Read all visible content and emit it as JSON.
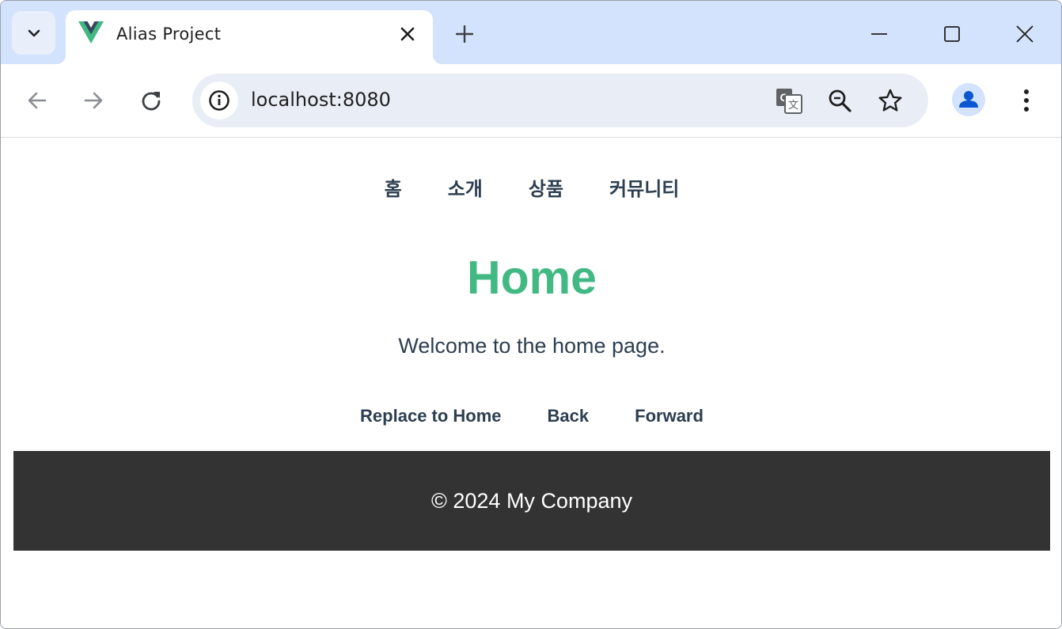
{
  "browser": {
    "tab": {
      "title": "Alias Project",
      "favicon": "vue-logo-icon"
    },
    "url": "localhost:8080",
    "icons": {
      "tab_search": "chevron-down-icon",
      "close_tab": "close-icon",
      "new_tab": "plus-icon",
      "minimize": "minimize-icon",
      "maximize": "maximize-icon",
      "close_window": "close-icon",
      "back": "arrow-left-icon",
      "forward": "arrow-right-icon",
      "reload": "reload-icon",
      "site_info": "info-icon",
      "translate": "translate-icon",
      "zoom": "zoom-out-icon",
      "bookmark": "star-icon",
      "profile": "person-icon",
      "menu": "more-vert-icon"
    }
  },
  "page": {
    "nav": [
      {
        "label": "홈"
      },
      {
        "label": "소개"
      },
      {
        "label": "상품"
      },
      {
        "label": "커뮤니티"
      }
    ],
    "title": "Home",
    "message": "Welcome to the home page.",
    "actions": [
      {
        "label": "Replace to Home"
      },
      {
        "label": "Back"
      },
      {
        "label": "Forward"
      }
    ],
    "footer": "© 2024 My Company",
    "colors": {
      "accent": "#42b883",
      "text": "#2c3e50",
      "footer_bg": "#333333"
    }
  }
}
